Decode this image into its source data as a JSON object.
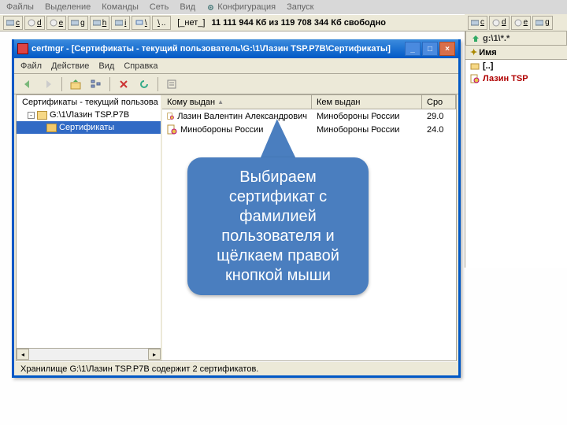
{
  "menubar": {
    "items": [
      "Файлы",
      "Выделение",
      "Команды",
      "Сеть",
      "Вид",
      "Конфигурация",
      "Запуск"
    ]
  },
  "drives": {
    "left": [
      "c",
      "d",
      "e",
      "g",
      "h",
      "i",
      "\\",
      "\\"
    ],
    "none": "[_нет_]",
    "free": "11 111 944 Кб из 119 708 344 Кб свободно",
    "right": [
      "c",
      "d",
      "e",
      "g"
    ]
  },
  "fm": {
    "tab": "g:\\1\\*.*",
    "head": "Имя",
    "up": "[..]",
    "file": "Лазин TSP"
  },
  "window": {
    "app": "certmgr",
    "title": "- [Сертификаты - текущий пользователь\\G:\\1\\Лазин TSP.P7B\\Сертификаты]",
    "menu": [
      "Файл",
      "Действие",
      "Вид",
      "Справка"
    ]
  },
  "tree": {
    "root": "Сертификаты - текущий пользова",
    "mid": "G:\\1\\Лазин TSP.P7B",
    "leaf": "Сертификаты"
  },
  "list": {
    "col_to": "Кому выдан",
    "col_by": "Кем выдан",
    "col_exp": "Сро",
    "rows": [
      {
        "to": "Лазин Валентин Александрович",
        "by": "Минобороны России",
        "exp": "29.0"
      },
      {
        "to": "Минобороны России",
        "by": "Минобороны России",
        "exp": "24.0"
      }
    ]
  },
  "status": "Хранилище G:\\1\\Лазин TSP.P7B содержит 2 сертификатов.",
  "callout": "Выбираем сертификат с фамилией пользователя и щёлкаем правой кнопкой мыши"
}
